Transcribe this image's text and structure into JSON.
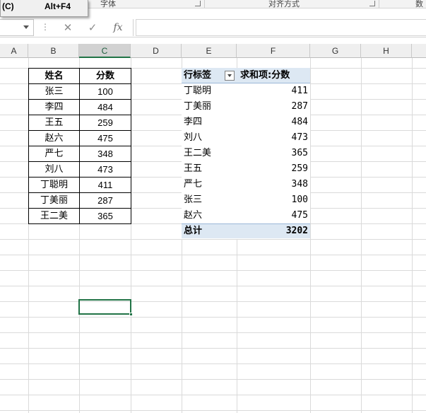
{
  "ribbon": {
    "groups": [
      "字体",
      "对齐方式",
      "数字"
    ]
  },
  "context_menu": {
    "item_label": "(C)",
    "item_shortcut": "Alt+F4"
  },
  "formula_bar": {
    "name_box": "",
    "cancel_icon": "✕",
    "enter_icon": "✓",
    "fx_label": "fx",
    "content": ""
  },
  "columns": [
    "A",
    "B",
    "C",
    "D",
    "E",
    "F",
    "G",
    "H"
  ],
  "active_column": "C",
  "source_table": {
    "headers": [
      "姓名",
      "分数"
    ],
    "rows": [
      [
        "张三",
        "100"
      ],
      [
        "李四",
        "484"
      ],
      [
        "王五",
        "259"
      ],
      [
        "赵六",
        "475"
      ],
      [
        "严七",
        "348"
      ],
      [
        "刘八",
        "473"
      ],
      [
        "丁聪明",
        "411"
      ],
      [
        "丁美丽",
        "287"
      ],
      [
        "王二美",
        "365"
      ]
    ]
  },
  "pivot": {
    "row_label_header": "行标签",
    "value_header": "求和项:分数",
    "rows": [
      [
        "丁聪明",
        "411"
      ],
      [
        "丁美丽",
        "287"
      ],
      [
        "李四",
        "484"
      ],
      [
        "刘八",
        "473"
      ],
      [
        "王二美",
        "365"
      ],
      [
        "王五",
        "259"
      ],
      [
        "严七",
        "348"
      ],
      [
        "张三",
        "100"
      ],
      [
        "赵六",
        "475"
      ]
    ],
    "total_label": "总计",
    "total_value": "3202"
  },
  "colors": {
    "accent": "#217346",
    "pivot_fill": "#dde8f3"
  }
}
